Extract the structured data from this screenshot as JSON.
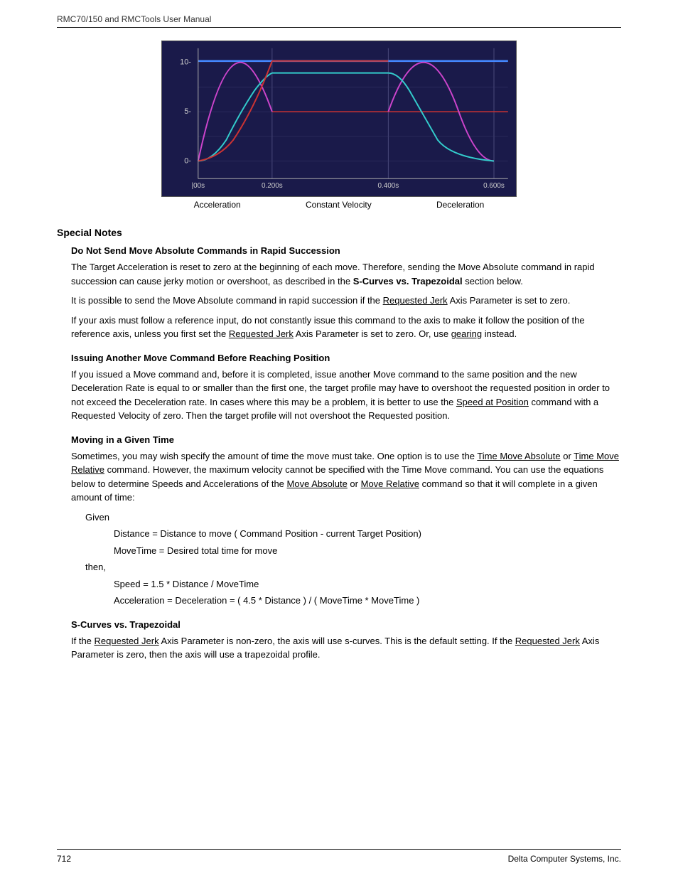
{
  "header": {
    "text": "RMC70/150 and RMCTools User Manual"
  },
  "chart": {
    "labels": [
      "Acceleration",
      "Constant Velocity",
      "Deceleration"
    ]
  },
  "content": {
    "section_title": "Special Notes",
    "subsections": [
      {
        "title": "Do Not Send Move Absolute Commands in Rapid Succession",
        "paragraphs": [
          "The Target Acceleration is reset to zero at the beginning of each move. Therefore, sending the Move Absolute command in rapid succession can cause jerky motion or overshoot, as described in the S-Curves vs. Trapezoidal section below.",
          "It is possible to send the Move Absolute command in rapid succession if the Requested Jerk  Axis Parameter is set to zero.",
          "If your axis must follow a reference input, do not constantly issue this command to the axis to make it follow the position of the reference axis, unless you first set the Requested Jerk  Axis Parameter is set to zero. Or, use gearing instead."
        ]
      },
      {
        "title": "Issuing Another Move Command Before Reaching Position",
        "paragraphs": [
          "If you issued a Move command and, before it is completed, issue another Move command to the same position and the new Deceleration Rate is equal to or smaller than the first one, the target profile may have to overshoot the requested position in order to not exceed the Deceleration rate. In cases where this may be a problem, it is better to use the Speed at Position command with a Requested Velocity of zero. Then the target profile will not overshoot the Requested position."
        ]
      },
      {
        "title": "Moving in a Given Time",
        "paragraphs": [
          "Sometimes, you may wish specify the amount of time the move must take. One option is to use the Time Move Absolute or Time Move Relative command. However, the maximum velocity cannot be specified with the Time Move command. You can use the equations below to determine Speeds and Accelerations of the Move Absolute or Move Relative command so that it will complete in a given amount of time:"
        ],
        "given_label": "Given",
        "given_items": [
          "Distance = Distance to move ( Command Position - current Target Position)",
          "MoveTime = Desired total time for move"
        ],
        "then_label": "then,",
        "then_items": [
          "Speed = 1.5 * Distance / MoveTime",
          "Acceleration = Deceleration = ( 4.5 * Distance ) / ( MoveTime * MoveTime )"
        ]
      },
      {
        "title": "S-Curves vs. Trapezoidal",
        "paragraphs": [
          "If the Requested Jerk Axis Parameter is non-zero, the axis will use s-curves. This is the default setting. If the Requested Jerk Axis Parameter is zero, then the axis will use a trapezoidal profile."
        ]
      }
    ]
  },
  "footer": {
    "page_number": "712",
    "company": "Delta Computer Systems, Inc."
  }
}
